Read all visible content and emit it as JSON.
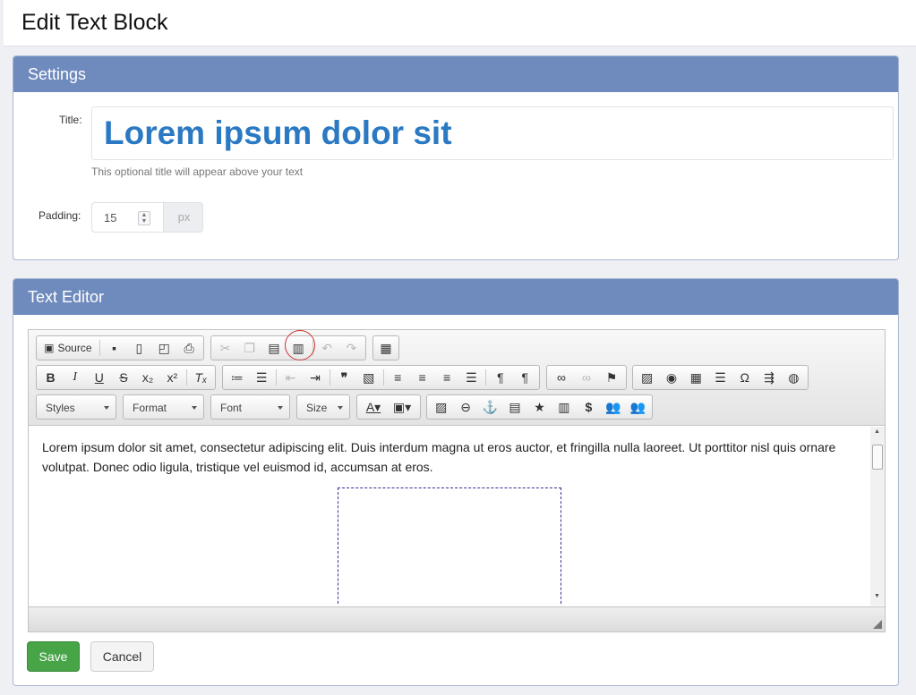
{
  "page": {
    "title": "Edit Text Block"
  },
  "settings": {
    "heading": "Settings",
    "title_label": "Title:",
    "title_value": "Lorem ipsum dolor sit",
    "title_help": "This optional title will appear above your text",
    "padding_label": "Padding:",
    "padding_value": "15",
    "padding_unit": "px"
  },
  "editor": {
    "heading": "Text Editor",
    "source_label": "Source",
    "styles": "Styles",
    "format": "Format",
    "font": "Font",
    "size": "Size",
    "content": "Lorem ipsum dolor sit amet, consectetur adipiscing elit. Duis interdum magna ut eros auctor, et fringilla nulla laoreet. Ut porttitor nisl quis ornare volutpat. Donec odio ligula, tristique vel euismod id, accumsan at eros."
  },
  "actions": {
    "save": "Save",
    "cancel": "Cancel"
  },
  "colors": {
    "accent_header": "#6f8bbd",
    "title_text": "#2a79c2",
    "save_button": "#47a447"
  }
}
